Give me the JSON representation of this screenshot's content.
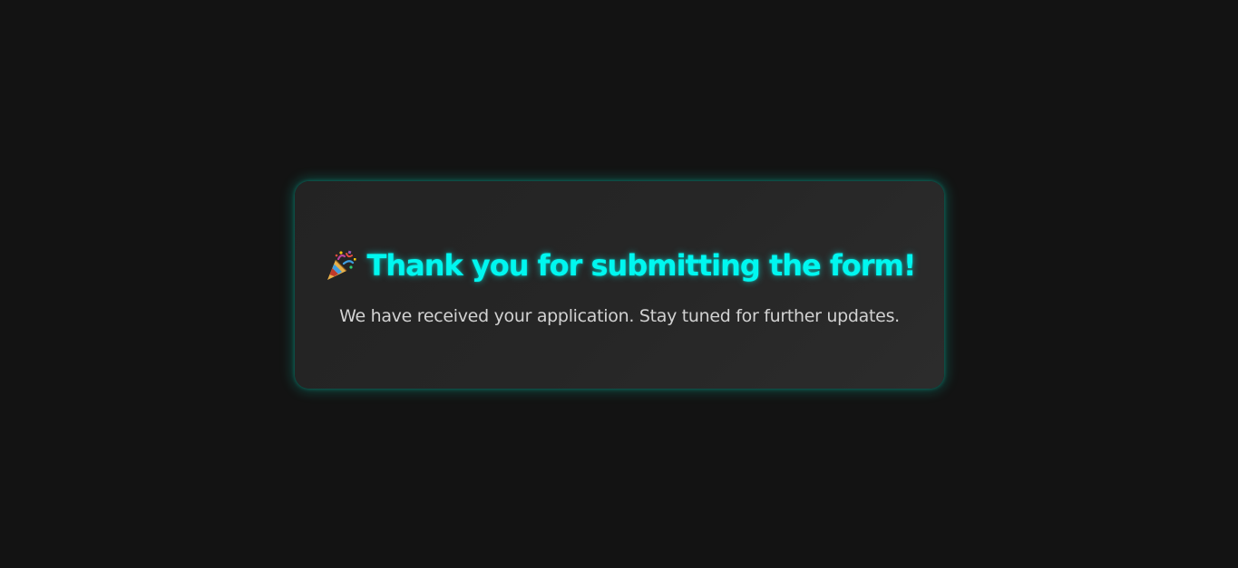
{
  "card": {
    "title": "Thank you for submitting the form!",
    "title_icon": "party-popper-icon",
    "message": "We have received your application. Stay tuned for further updates."
  },
  "colors": {
    "background": "#131313",
    "card": "#262626",
    "accent": "#00f7f0",
    "message_text": "#d2d2d2"
  }
}
